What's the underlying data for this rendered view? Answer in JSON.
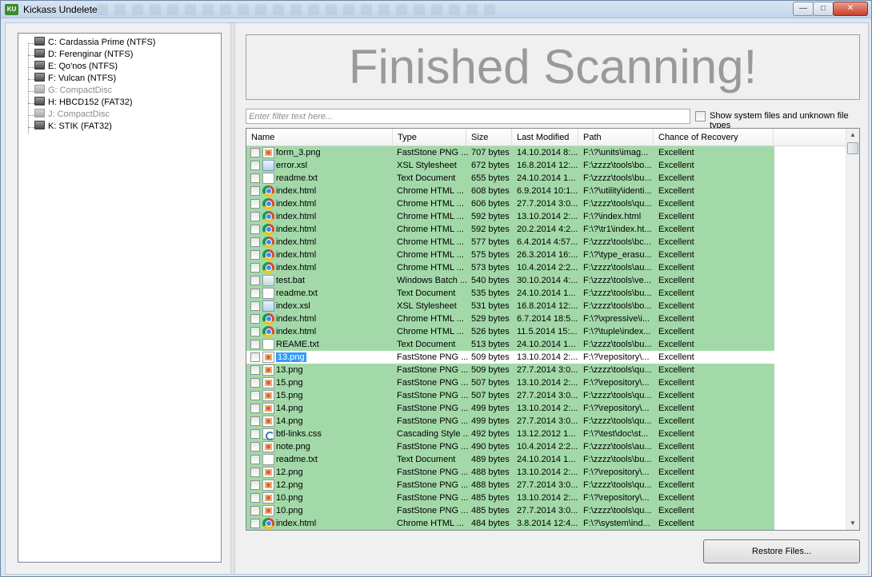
{
  "window": {
    "title": "Kickass Undelete",
    "icon_text": "KU",
    "controls": {
      "minimize": "—",
      "maximize": "□",
      "close": "✕"
    }
  },
  "tree": {
    "items": [
      {
        "label": "C: Cardassia Prime (NTFS)",
        "enabled": true
      },
      {
        "label": "D: Ferenginar (NTFS)",
        "enabled": true
      },
      {
        "label": "E: Qo'nos (NTFS)",
        "enabled": true
      },
      {
        "label": "F: Vulcan (NTFS)",
        "enabled": true
      },
      {
        "label": "G: CompactDisc",
        "enabled": false
      },
      {
        "label": "H: HBCD152 (FAT32)",
        "enabled": true
      },
      {
        "label": "J: CompactDisc",
        "enabled": false
      },
      {
        "label": "K: STIK (FAT32)",
        "enabled": true
      }
    ]
  },
  "banner": {
    "text": "Finished Scanning!"
  },
  "filter": {
    "placeholder": "Enter filter text here...",
    "value": "",
    "show_system_label": "Show system files and unknown file types",
    "show_system_checked": false
  },
  "list": {
    "columns": [
      "Name",
      "Type",
      "Size",
      "Last Modified",
      "Path",
      "Chance of Recovery"
    ],
    "rows": [
      {
        "icon": "png",
        "name": "form_3.png",
        "type": "FastStone PNG ...",
        "size": "707 bytes",
        "modified": "14.10.2014 8:...",
        "path": "F:\\?\\units\\imag...",
        "recovery": "Excellent"
      },
      {
        "icon": "xsl",
        "name": "error.xsl",
        "type": "XSL Stylesheet",
        "size": "672 bytes",
        "modified": "16.8.2014 12:...",
        "path": "F:\\zzzz\\tools\\bo...",
        "recovery": "Excellent"
      },
      {
        "icon": "txt",
        "name": "readme.txt",
        "type": "Text Document",
        "size": "655 bytes",
        "modified": "24.10.2014 1...",
        "path": "F:\\zzzz\\tools\\bu...",
        "recovery": "Excellent"
      },
      {
        "icon": "html",
        "name": "index.html",
        "type": "Chrome HTML ...",
        "size": "608 bytes",
        "modified": "6.9.2014 10:1...",
        "path": "F:\\?\\utility\\identi...",
        "recovery": "Excellent"
      },
      {
        "icon": "html",
        "name": "index.html",
        "type": "Chrome HTML ...",
        "size": "606 bytes",
        "modified": "27.7.2014 3:0...",
        "path": "F:\\zzzz\\tools\\qu...",
        "recovery": "Excellent"
      },
      {
        "icon": "html",
        "name": "index.html",
        "type": "Chrome HTML ...",
        "size": "592 bytes",
        "modified": "13.10.2014 2:...",
        "path": "F:\\?\\index.html",
        "recovery": "Excellent"
      },
      {
        "icon": "html",
        "name": "index.html",
        "type": "Chrome HTML ...",
        "size": "592 bytes",
        "modified": "20.2.2014 4:2...",
        "path": "F:\\?\\tr1\\index.ht...",
        "recovery": "Excellent"
      },
      {
        "icon": "html",
        "name": "index.html",
        "type": "Chrome HTML ...",
        "size": "577 bytes",
        "modified": "6.4.2014 4:57...",
        "path": "F:\\zzzz\\tools\\bc...",
        "recovery": "Excellent"
      },
      {
        "icon": "html",
        "name": "index.html",
        "type": "Chrome HTML ...",
        "size": "575 bytes",
        "modified": "26.3.2014 16:...",
        "path": "F:\\?\\type_erasu...",
        "recovery": "Excellent"
      },
      {
        "icon": "html",
        "name": "index.html",
        "type": "Chrome HTML ...",
        "size": "573 bytes",
        "modified": "10.4.2014 2:2...",
        "path": "F:\\zzzz\\tools\\au...",
        "recovery": "Excellent"
      },
      {
        "icon": "bat",
        "name": "test.bat",
        "type": "Windows Batch ...",
        "size": "540 bytes",
        "modified": "30.10.2014 4:...",
        "path": "F:\\zzzz\\tools\\ve...",
        "recovery": "Excellent"
      },
      {
        "icon": "txt",
        "name": "readme.txt",
        "type": "Text Document",
        "size": "535 bytes",
        "modified": "24.10.2014 1...",
        "path": "F:\\zzzz\\tools\\bu...",
        "recovery": "Excellent"
      },
      {
        "icon": "xsl",
        "name": "index.xsl",
        "type": "XSL Stylesheet",
        "size": "531 bytes",
        "modified": "16.8.2014 12:...",
        "path": "F:\\zzzz\\tools\\bo...",
        "recovery": "Excellent"
      },
      {
        "icon": "html",
        "name": "index.html",
        "type": "Chrome HTML ...",
        "size": "529 bytes",
        "modified": "6.7.2014 18:5...",
        "path": "F:\\?\\xpressive\\i...",
        "recovery": "Excellent"
      },
      {
        "icon": "html",
        "name": "index.html",
        "type": "Chrome HTML ...",
        "size": "526 bytes",
        "modified": "11.5.2014 15:...",
        "path": "F:\\?\\tuple\\index...",
        "recovery": "Excellent"
      },
      {
        "icon": "txt",
        "name": "REAME.txt",
        "type": "Text Document",
        "size": "513 bytes",
        "modified": "24.10.2014 1...",
        "path": "F:\\zzzz\\tools\\bu...",
        "recovery": "Excellent"
      },
      {
        "icon": "png",
        "name": "13.png",
        "type": "FastStone PNG ...",
        "size": "509 bytes",
        "modified": "13.10.2014 2:...",
        "path": "F:\\?\\repository\\...",
        "recovery": "Excellent",
        "selected": true
      },
      {
        "icon": "png",
        "name": "13.png",
        "type": "FastStone PNG ...",
        "size": "509 bytes",
        "modified": "27.7.2014 3:0...",
        "path": "F:\\zzzz\\tools\\qu...",
        "recovery": "Excellent"
      },
      {
        "icon": "png",
        "name": "15.png",
        "type": "FastStone PNG ...",
        "size": "507 bytes",
        "modified": "13.10.2014 2:...",
        "path": "F:\\?\\repository\\...",
        "recovery": "Excellent"
      },
      {
        "icon": "png",
        "name": "15.png",
        "type": "FastStone PNG ...",
        "size": "507 bytes",
        "modified": "27.7.2014 3:0...",
        "path": "F:\\zzzz\\tools\\qu...",
        "recovery": "Excellent"
      },
      {
        "icon": "png",
        "name": "14.png",
        "type": "FastStone PNG ...",
        "size": "499 bytes",
        "modified": "13.10.2014 2:...",
        "path": "F:\\?\\repository\\...",
        "recovery": "Excellent"
      },
      {
        "icon": "png",
        "name": "14.png",
        "type": "FastStone PNG ...",
        "size": "499 bytes",
        "modified": "27.7.2014 3:0...",
        "path": "F:\\zzzz\\tools\\qu...",
        "recovery": "Excellent"
      },
      {
        "icon": "css",
        "name": "btl-links.css",
        "type": "Cascading Style ...",
        "size": "492 bytes",
        "modified": "13.12.2012 1...",
        "path": "F:\\?\\test\\doc\\st...",
        "recovery": "Excellent"
      },
      {
        "icon": "png",
        "name": "note.png",
        "type": "FastStone PNG ...",
        "size": "490 bytes",
        "modified": "10.4.2014 2:2...",
        "path": "F:\\zzzz\\tools\\au...",
        "recovery": "Excellent"
      },
      {
        "icon": "txt",
        "name": "readme.txt",
        "type": "Text Document",
        "size": "489 bytes",
        "modified": "24.10.2014 1...",
        "path": "F:\\zzzz\\tools\\bu...",
        "recovery": "Excellent"
      },
      {
        "icon": "png",
        "name": "12.png",
        "type": "FastStone PNG ...",
        "size": "488 bytes",
        "modified": "13.10.2014 2:...",
        "path": "F:\\?\\repository\\...",
        "recovery": "Excellent"
      },
      {
        "icon": "png",
        "name": "12.png",
        "type": "FastStone PNG ...",
        "size": "488 bytes",
        "modified": "27.7.2014 3:0...",
        "path": "F:\\zzzz\\tools\\qu...",
        "recovery": "Excellent"
      },
      {
        "icon": "png",
        "name": "10.png",
        "type": "FastStone PNG ...",
        "size": "485 bytes",
        "modified": "13.10.2014 2:...",
        "path": "F:\\?\\repository\\...",
        "recovery": "Excellent"
      },
      {
        "icon": "png",
        "name": "10.png",
        "type": "FastStone PNG ...",
        "size": "485 bytes",
        "modified": "27.7.2014 3:0...",
        "path": "F:\\zzzz\\tools\\qu...",
        "recovery": "Excellent"
      },
      {
        "icon": "html",
        "name": "index.html",
        "type": "Chrome HTML ...",
        "size": "484 bytes",
        "modified": "3.8.2014 12:4...",
        "path": "F:\\?\\system\\ind...",
        "recovery": "Excellent"
      }
    ]
  },
  "actions": {
    "restore_label": "Restore Files..."
  },
  "colors": {
    "row_highlight": "#a3d9a9",
    "selection": "#3399ff",
    "banner_text": "#9a9a9a"
  }
}
